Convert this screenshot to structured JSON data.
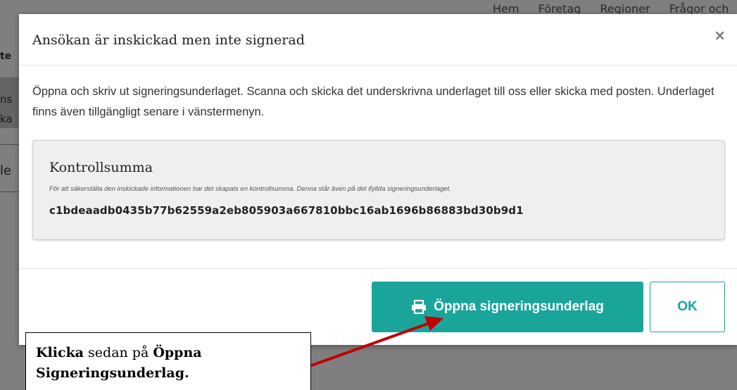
{
  "background": {
    "nav_items": [
      "Hem",
      "Företag",
      "Regioner",
      "Frågor och"
    ],
    "fragments": [
      "te",
      "ns",
      "ka",
      "le"
    ]
  },
  "modal": {
    "title": "Ansökan är inskickad men inte signerad",
    "close_icon": "close-icon",
    "body_text": "Öppna och skriv ut signeringsunderlaget. Scanna och skicka det underskrivna underlaget till oss eller skicka med posten. Underlaget finns även tillgängligt senare i vänstermenyn.",
    "checksum": {
      "title": "Kontrollsumma",
      "description": "För att säkerställa den inskickade informationen har det skapats en kontrollsumma. Denna står även på det ifyllda signeringsunderlaget.",
      "value": "c1bdeaadb0435b77b62559a2eb805903a667810bbc16ab1696b86883bd30b9d1"
    },
    "buttons": {
      "open_label": "Öppna signeringsunderlag",
      "open_icon": "printer-icon",
      "ok_label": "OK"
    },
    "colors": {
      "accent": "#1aa59b",
      "overlay": "rgba(0,0,0,0.5)"
    }
  },
  "annotation": {
    "text_bold_1": "Klicka",
    "text_plain": " sedan på ",
    "text_bold_2": "Öppna Signeringsunderlag.",
    "arrow_color": "#c00000"
  }
}
